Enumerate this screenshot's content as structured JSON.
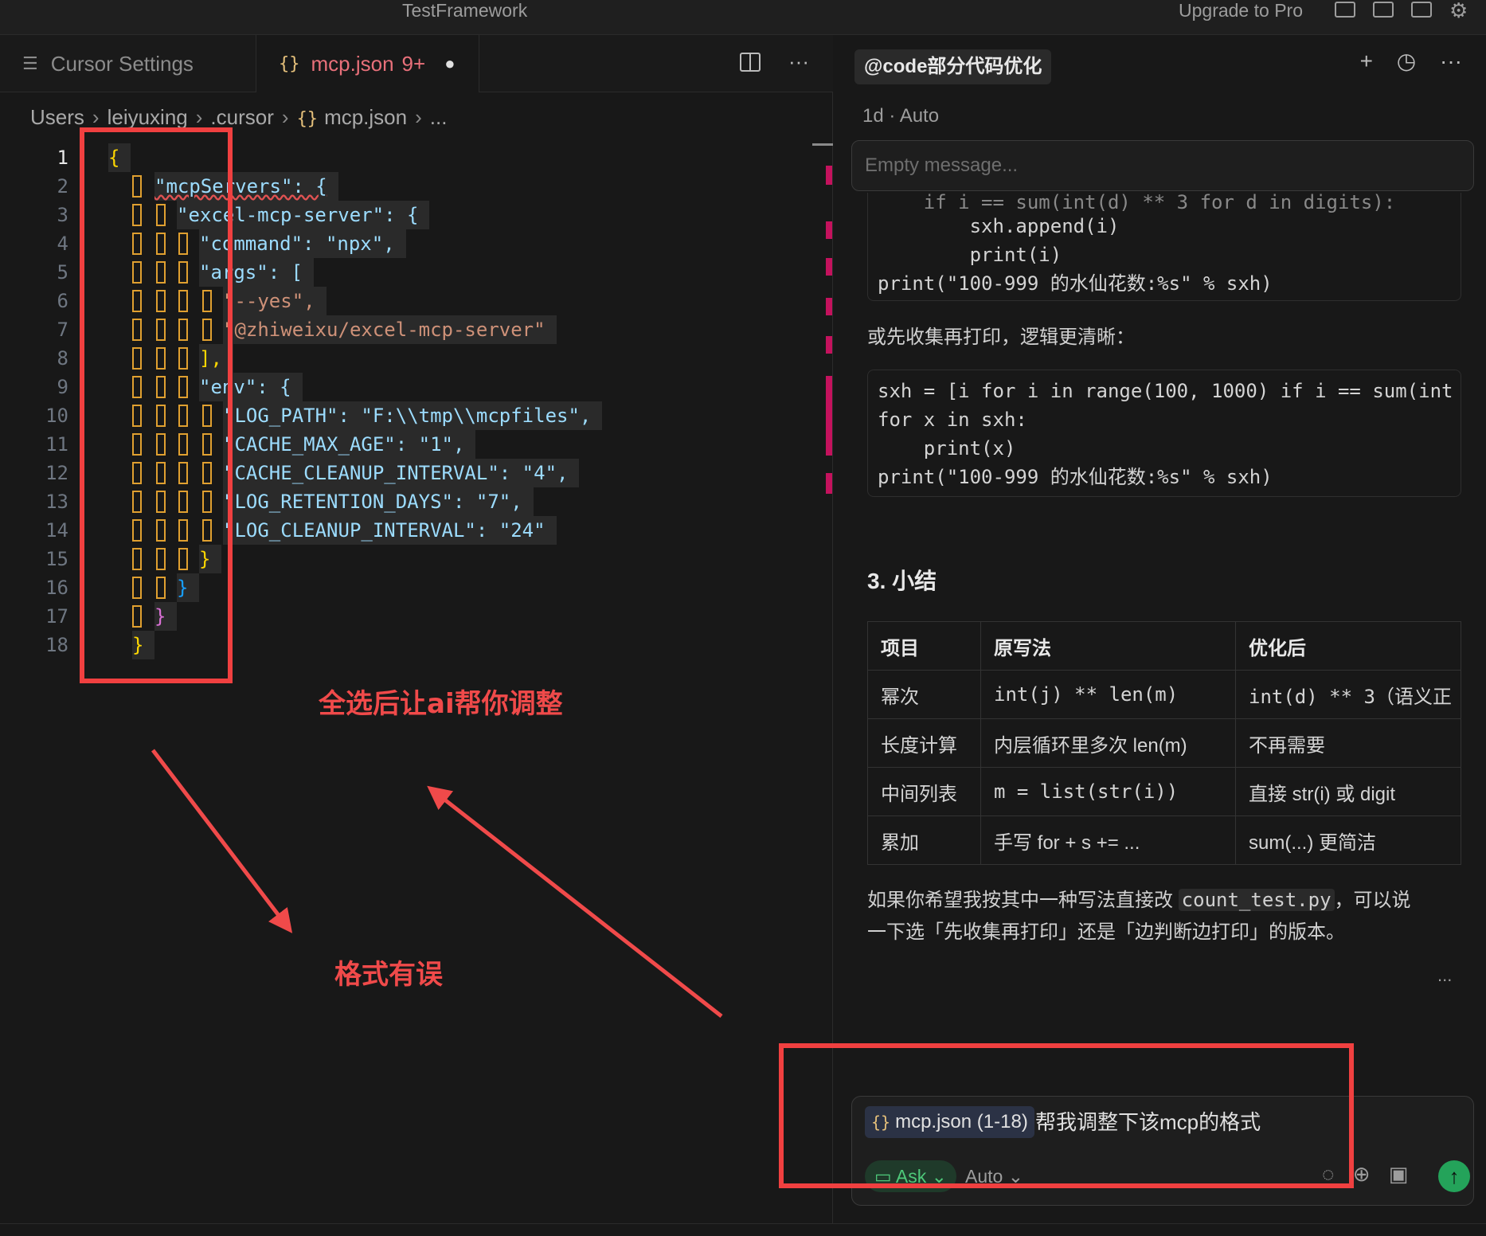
{
  "window": {
    "title": "TestFramework",
    "upgrade_label": "Upgrade to Pro"
  },
  "editor": {
    "tabs": [
      {
        "label": "Cursor Settings",
        "icon": "settings-sliders-icon"
      },
      {
        "label": "mcp.json",
        "badge": "9+",
        "modified": true,
        "icon": "json-braces-icon"
      }
    ],
    "breadcrumb": [
      "Users",
      "leiyuxing",
      ".cursor",
      "mcp.json",
      "..."
    ],
    "line_numbers": [
      "1",
      "2",
      "3",
      "4",
      "5",
      "6",
      "7",
      "8",
      "9",
      "10",
      "11",
      "12",
      "13",
      "14",
      "15",
      "16",
      "17",
      "18"
    ],
    "lines": [
      "{",
      "\"mcpServers\": {",
      "\"excel-mcp-server\": {",
      "\"command\": \"npx\",",
      "\"args\": [",
      "\"--yes\",",
      "\"@zhiweixu/excel-mcp-server\"",
      "],",
      "\"env\": {",
      "\"LOG_PATH\": \"F:\\\\tmp\\\\mcpfiles\",",
      "\"CACHE_MAX_AGE\": \"1\",",
      "\"CACHE_CLEANUP_INTERVAL\": \"4\",",
      "\"LOG_RETENTION_DAYS\": \"7\",",
      "\"LOG_CLEANUP_INTERVAL\": \"24\"",
      "}",
      "}",
      "}",
      "}"
    ]
  },
  "annotations": {
    "select_all_note": "全选后让ai帮你调整",
    "format_error_note": "格式有误"
  },
  "chat": {
    "header_title": "@code部分代码优化",
    "meta": "1d · Auto",
    "empty_placeholder": "Empty message...",
    "code1": [
      "    if i == sum(int(d) ** 3 for d in digits):",
      "        sxh.append(i)",
      "        print(i)",
      "print(\"100-999 的水仙花数:%s\" % sxh)"
    ],
    "para1": "或先收集再打印，逻辑更清晰：",
    "code2": [
      "sxh = [i for i in range(100, 1000) if i == sum(int",
      "for x in sxh:",
      "    print(x)",
      "print(\"100-999 的水仙花数:%s\" % sxh)"
    ],
    "section_title": "3. 小结",
    "table": {
      "headers": [
        "项目",
        "原写法",
        "优化后"
      ],
      "rows": [
        [
          "幂次",
          "int(j) ** len(m)",
          "int(d) ** 3（语义正"
        ],
        [
          "长度计算",
          "内层循环里多次 len(m)",
          "不再需要"
        ],
        [
          "中间列表",
          "m = list(str(i))",
          "直接 str(i) 或 digit"
        ],
        [
          "累加",
          "手写 for + s += ...",
          "sum(...) 更简洁"
        ]
      ]
    },
    "para2_a": "如果你希望我按其中一种写法直接改 ",
    "para2_code": "count_test.py",
    "para2_b": "，可以说",
    "para2_c": "一下选「先收集再打印」还是「边判断边打印」的版本。",
    "ellipsis": "...",
    "composer": {
      "file_chip": "mcp.json (1-18)",
      "text": "帮我调整下该mcp的格式",
      "mode": "Ask",
      "model": "Auto"
    }
  },
  "colors": {
    "accent_red": "#f04040",
    "send_green": "#24a35a",
    "json_braces": "#e5c07b"
  }
}
